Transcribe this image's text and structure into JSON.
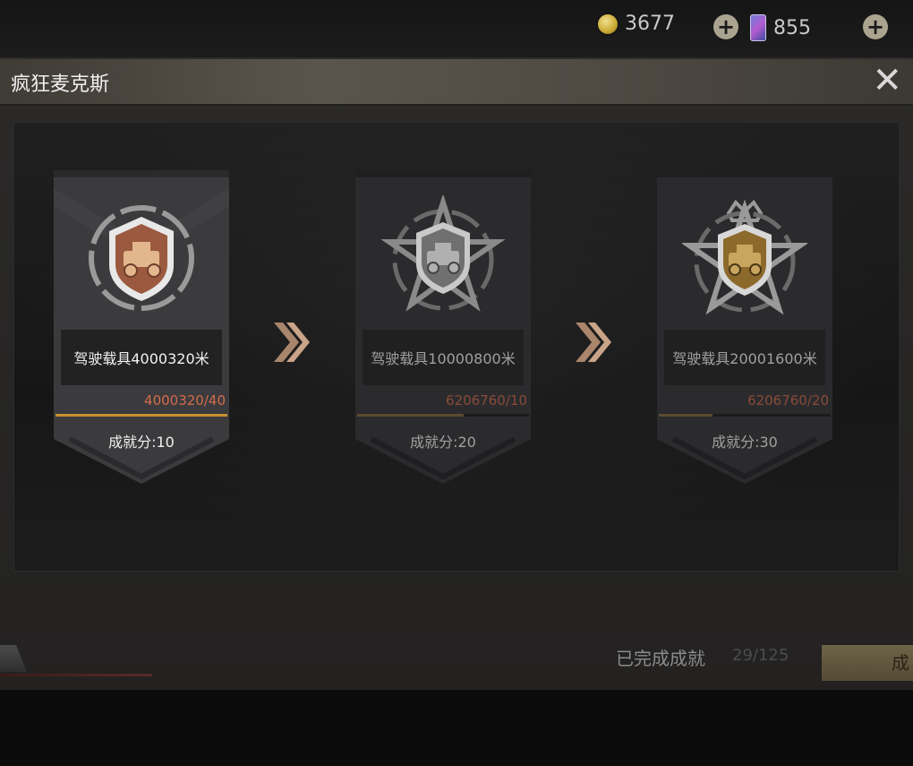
{
  "header": {
    "coins": "3677",
    "gems": "855",
    "coin_icon": "gold-coin-icon",
    "gem_icon": "gem-card-icon",
    "plus_label": "+"
  },
  "dialog": {
    "title": "疯狂麦克斯",
    "close_label": "✕"
  },
  "achievements": [
    {
      "task": "驾驶载具4000320米",
      "progress_text": "4000320/40",
      "progress": 1.0,
      "score": "成就分:10",
      "tier": "bronze",
      "unlocked": true,
      "badge_color": "#b0644a"
    },
    {
      "task": "驾驶载具10000800米",
      "progress_text": "6206760/10",
      "progress": 0.62,
      "score": "成就分:20",
      "tier": "silver",
      "unlocked": false,
      "badge_color": "#8f8f8f"
    },
    {
      "task": "驾驶载具20001600米",
      "progress_text": "6206760/20",
      "progress": 0.31,
      "score": "成就分:30",
      "tier": "gold",
      "unlocked": false,
      "badge_color": "#b8903f"
    }
  ],
  "footer": {
    "completed_label": "已完成成就",
    "completed_count": "29/125",
    "button_label": "成"
  },
  "colors": {
    "accent": "#c8912e",
    "progress_text": "#d36b4c"
  }
}
